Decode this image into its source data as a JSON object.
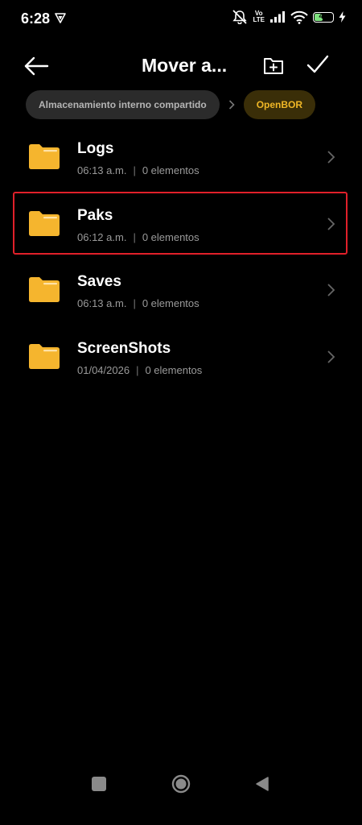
{
  "status_bar": {
    "time": "6:28",
    "volte_top": "Vo",
    "volte_bottom": "LTE",
    "battery": "48",
    "battery_level": 0.48,
    "icons": [
      "vpn-icon",
      "mute-icon",
      "volte-icon",
      "signal-icon",
      "wifi-icon",
      "battery-icon",
      "charging-icon"
    ]
  },
  "header": {
    "title": "Mover a...",
    "back_icon": "arrow-left-icon",
    "new_folder_icon": "folder-plus-icon",
    "confirm_icon": "check-icon"
  },
  "breadcrumb": {
    "root": "Almacenamiento interno compartido",
    "current": "OpenBOR"
  },
  "folders": [
    {
      "name": "Logs",
      "date": "06:13 a.m.",
      "count": "0 elementos"
    },
    {
      "name": "Paks",
      "date": "06:12 a.m.",
      "count": "0 elementos",
      "highlighted": true
    },
    {
      "name": "Saves",
      "date": "06:13 a.m.",
      "count": "0 elementos"
    },
    {
      "name": "ScreenShots",
      "date": "01/04/2026",
      "count": "0 elementos"
    }
  ],
  "colors": {
    "background": "#000000",
    "accent": "#f0b726",
    "folder": "#f5b52e",
    "highlight": "#e0202a",
    "meta_text": "#9a9a9a"
  },
  "nav_bar": {
    "icons": [
      "recents-icon",
      "home-icon",
      "back-icon"
    ]
  }
}
